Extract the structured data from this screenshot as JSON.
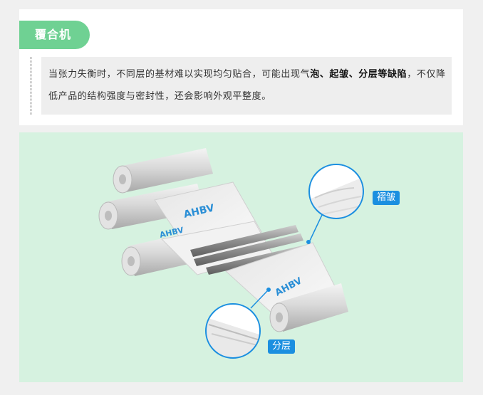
{
  "section": {
    "title": "覆合机",
    "text": {
      "part1": "当张力失衡时，不同层的基材难以实现均匀贴合，可能出现气",
      "bold1": "泡、起皱、分层等缺陷",
      "part2": "，不仅降低产品的结构强度与密封性，还会影响外观平整度。"
    }
  },
  "illustration": {
    "brand_logo": "AHBV",
    "callouts": {
      "wrinkle_label": "褶皱",
      "delamination_label": "分层"
    }
  },
  "colors": {
    "accent_green": "#6fd193",
    "panel_bg": "#d6f2e0",
    "callout_blue": "#1b8fe0"
  }
}
